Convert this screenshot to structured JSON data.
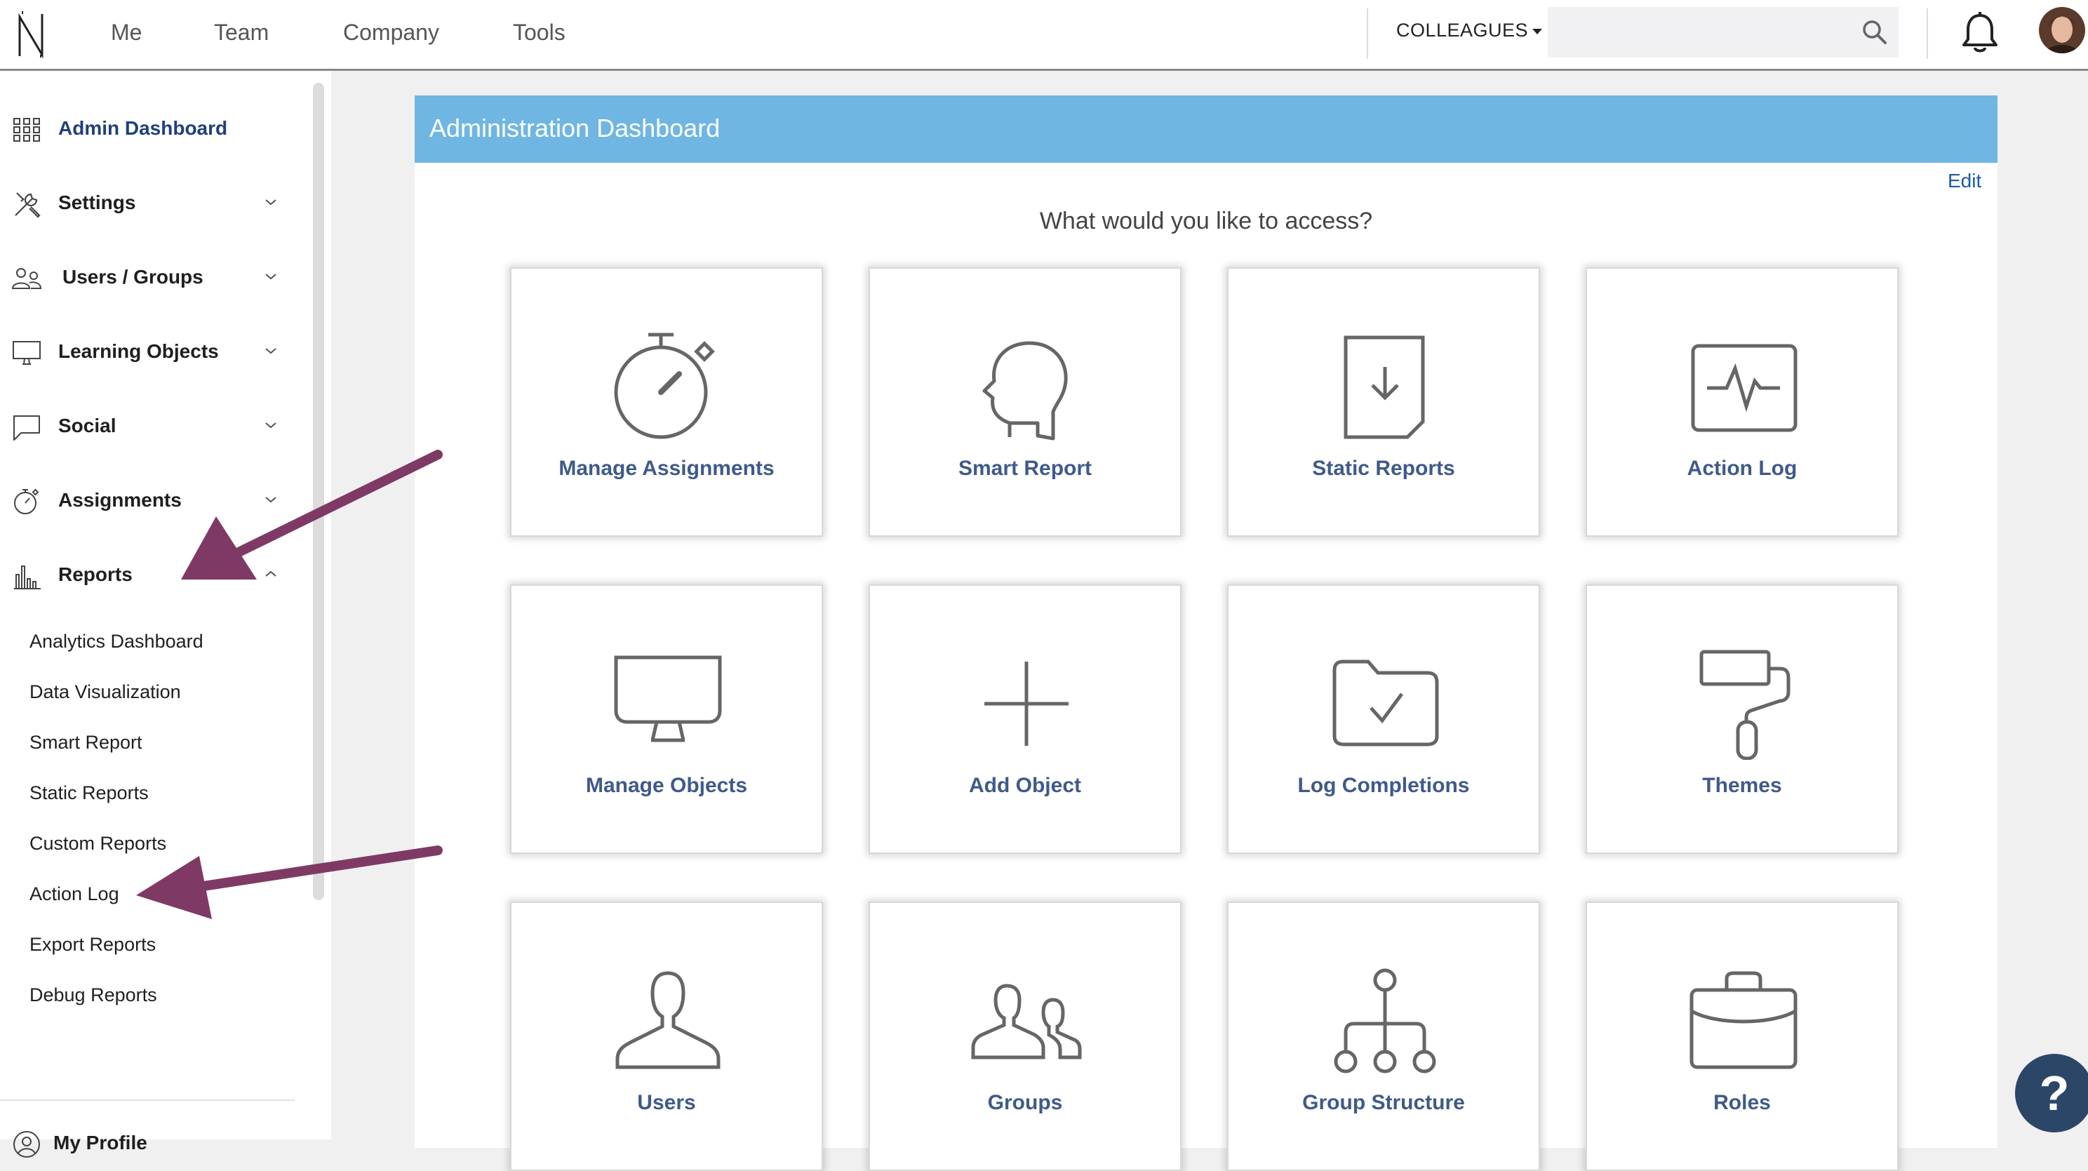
{
  "topnav": {
    "items": [
      "Me",
      "Team",
      "Company",
      "Tools"
    ],
    "colleagues_label": "COLLEAGUES",
    "search_placeholder": ""
  },
  "sidebar": {
    "items": [
      {
        "label": "Admin Dashboard",
        "icon": "grid-icon"
      },
      {
        "label": "Settings",
        "icon": "tools-icon"
      },
      {
        "label": "Users / Groups",
        "icon": "users-icon"
      },
      {
        "label": "Learning Objects",
        "icon": "monitor-icon"
      },
      {
        "label": "Social",
        "icon": "chat-icon"
      },
      {
        "label": "Assignments",
        "icon": "stopwatch-icon"
      },
      {
        "label": "Reports",
        "icon": "bar-chart-icon"
      }
    ],
    "reports_subitems": [
      "Analytics Dashboard",
      "Data Visualization",
      "Smart Report",
      "Static Reports",
      "Custom Reports",
      "Action Log",
      "Export Reports",
      "Debug Reports"
    ],
    "profile_label": "My Profile"
  },
  "main": {
    "title": "Administration Dashboard",
    "edit_label": "Edit",
    "prompt": "What would you like to access?",
    "tiles": [
      {
        "label": "Manage Assignments",
        "icon": "stopwatch-icon"
      },
      {
        "label": "Smart Report",
        "icon": "head-icon"
      },
      {
        "label": "Static Reports",
        "icon": "document-download-icon"
      },
      {
        "label": "Action Log",
        "icon": "activity-icon"
      },
      {
        "label": "Manage Objects",
        "icon": "monitor-icon"
      },
      {
        "label": "Add Object",
        "icon": "plus-icon"
      },
      {
        "label": "Log Completions",
        "icon": "folder-check-icon"
      },
      {
        "label": "Themes",
        "icon": "paint-roller-icon"
      },
      {
        "label": "Users",
        "icon": "user-icon"
      },
      {
        "label": "Groups",
        "icon": "users-icon"
      },
      {
        "label": "Group Structure",
        "icon": "hierarchy-icon"
      },
      {
        "label": "Roles",
        "icon": "briefcase-icon"
      }
    ]
  },
  "help_label": "?",
  "colors": {
    "header_blue": "#6fb6e2",
    "tile_label": "#3f5a8a",
    "arrow": "#7e3a64",
    "help_button": "#2c4668"
  }
}
